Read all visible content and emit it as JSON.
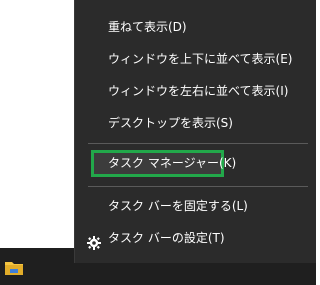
{
  "menu": {
    "items": [
      {
        "label": "重ねて表示(D)"
      },
      {
        "label": "ウィンドウを上下に並べて表示(E)"
      },
      {
        "label": "ウィンドウを左右に並べて表示(I)"
      },
      {
        "label": "デスクトップを表示(S)"
      },
      {
        "label": "タスク マネージャー(K)"
      },
      {
        "label": "タスク バーを固定する(L)"
      },
      {
        "label": "タスク バーの設定(T)",
        "icon": "gear-icon"
      }
    ],
    "highlighted_index": 4
  },
  "taskbar": {
    "icon": "file-explorer-icon"
  },
  "colors": {
    "menu_bg": "#2b2b2b",
    "taskbar_bg": "#1f1f1f",
    "focus_outline": "#22a84a",
    "text": "#ffffff"
  }
}
